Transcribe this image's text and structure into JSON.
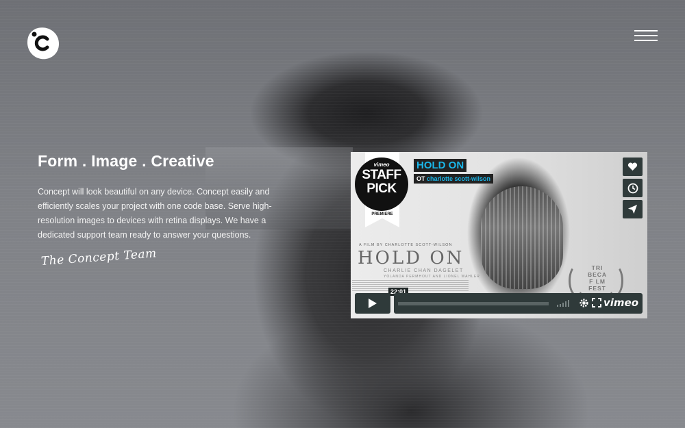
{
  "hero": {
    "title": "Form . Image . Creative",
    "body": "Concept will look beautiful on any device. Concept easily and efficiently scales your project with one code base. Serve high-resolution images to devices with retina displays. We have a dedicated support team ready to answer your questions.",
    "signature": "The Concept Team"
  },
  "video": {
    "badge_vimeo": "vimeo",
    "badge_staff": "STAFF",
    "badge_pick": "PICK",
    "badge_premiere": "PREMIERE",
    "title": "HOLD ON",
    "byline_prefix": "OT",
    "byline_author": "charlotte scott-wilson",
    "poster_film_by": "A FILM BY CHARLOTTE SCOTT-WILSON",
    "poster_title": "HOLD ON",
    "poster_cast_1": "CHARLIE CHAN DAGELET",
    "poster_cast_2": "YOLANDA PERMHOUT AND LIONEL WAHLER",
    "festival_1": "TRI BECA",
    "festival_2": "F LM",
    "festival_3": "FEST VAL",
    "time": "22:01",
    "brand": "vimeo"
  },
  "colors": {
    "accent": "#1ab7ea",
    "control_bg": "#2f3a3a"
  },
  "icons": {
    "logo": "concept-logo-icon",
    "menu": "hamburger-menu-icon",
    "like": "heart-icon",
    "watch_later": "clock-icon",
    "share": "paper-plane-icon",
    "play": "play-icon",
    "settings": "gear-icon",
    "fullscreen": "fullscreen-icon"
  }
}
